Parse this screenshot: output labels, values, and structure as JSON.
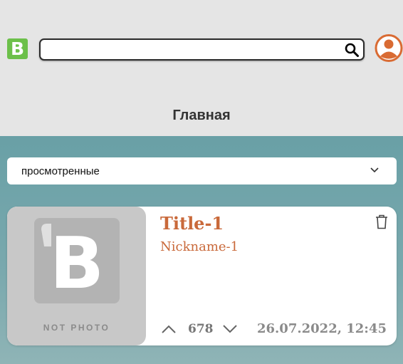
{
  "header": {
    "logo_letter": "B",
    "search": {
      "value": "",
      "placeholder": ""
    },
    "page_title": "Главная"
  },
  "filter": {
    "selected": "просмотренные"
  },
  "posts": [
    {
      "title": "Title-1",
      "nickname": "Nickname-1",
      "image_label": "NOT PHOTO",
      "votes": "678",
      "date": "26.07.2022, 12:45"
    }
  ],
  "colors": {
    "brand_green": "#6cc04a",
    "accent": "#c9693a",
    "content_bg": "#69a0a6",
    "header_bg": "#e5e5e5"
  },
  "icons": [
    "logo-icon",
    "search-icon",
    "user-avatar-icon",
    "chevron-down-icon",
    "trash-icon",
    "arrow-up-icon",
    "arrow-down-icon"
  ]
}
